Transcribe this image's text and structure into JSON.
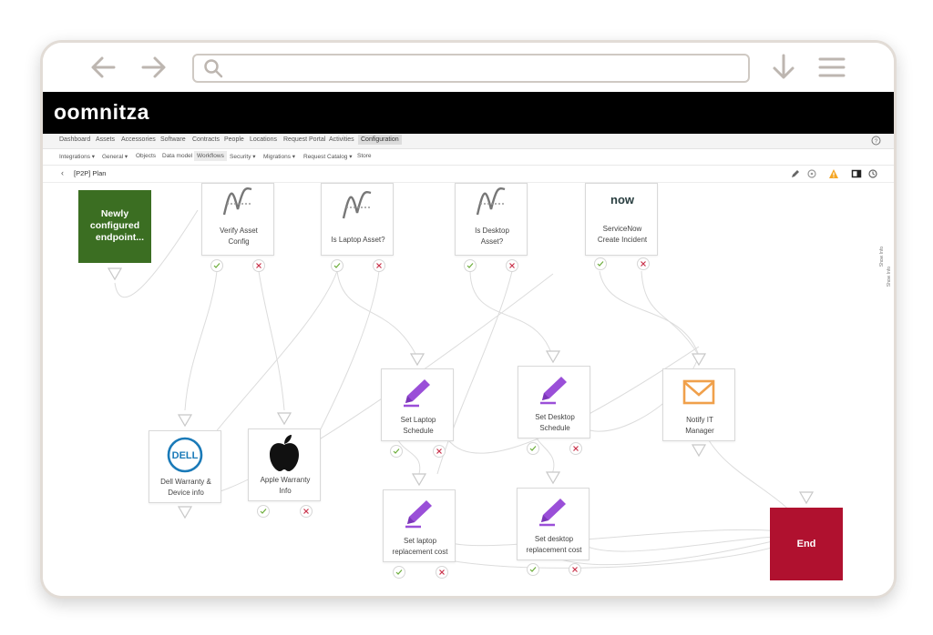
{
  "browser": {
    "url_value": ""
  },
  "app": {
    "logo_text": "oomnitza"
  },
  "menu": {
    "items": [
      "Dashboard",
      "Assets",
      "Accessories",
      "Software",
      "Contracts",
      "People",
      "Locations",
      "Request Portal",
      "Activities",
      "Configuration"
    ],
    "active": "Configuration"
  },
  "submenu": {
    "items": [
      "Integrations ▾",
      "General ▾",
      "Objects",
      "Data model",
      "Workflows",
      "Security ▾",
      "Migrations ▾",
      "Request Catalog ▾",
      "Store"
    ],
    "active": "Workflows"
  },
  "breadcrumb": {
    "back": "‹",
    "title": "[P2P] Plan"
  },
  "side_panel": {
    "label_1": "Show Info",
    "label_2": "Show Info"
  },
  "nodes": {
    "start": {
      "line1": "Newly",
      "line2": "configured",
      "line3": "endpoint..."
    },
    "verify_asset": {
      "line1": "Verify Asset",
      "line2": "Config"
    },
    "is_laptop": {
      "line1": "Is Laptop Asset?"
    },
    "is_desktop": {
      "line1": "Is Desktop",
      "line2": "Asset?"
    },
    "servicenow": {
      "logo": "now",
      "line1": "ServiceNow",
      "line2": "Create Incident"
    },
    "set_laptop_schedule": {
      "line1": "Set Laptop",
      "line2": "Schedule"
    },
    "set_desktop_schedule": {
      "line1": "Set Desktop",
      "line2": "Schedule"
    },
    "notify_it": {
      "line1": "Notify IT",
      "line2": "Manager"
    },
    "dell": {
      "logo": "DELL",
      "line1": "Dell Warranty &",
      "line2": "Device info"
    },
    "apple": {
      "line1": "Apple Warranty",
      "line2": "Info"
    },
    "laptop_cost": {
      "line1": "Set laptop",
      "line2": "replacement cost"
    },
    "desktop_cost": {
      "line1": "Set desktop",
      "line2": "replacement cost"
    },
    "end": {
      "label": "End"
    }
  },
  "colors": {
    "start_bg": "#3b6e22",
    "end_bg": "#b0112f",
    "pencil": "#9a4fd8",
    "mail": "#f0a04b",
    "dell": "#1a7ab8",
    "check": "#6cad3a",
    "cross": "#c9324a",
    "warning": "#f5a623"
  }
}
